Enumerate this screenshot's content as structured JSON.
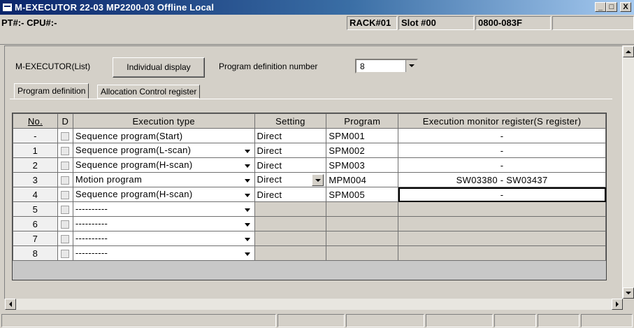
{
  "window": {
    "title": "M-EXECUTOR   22-03   MP2200-03 Offline  Local",
    "minimize": "_",
    "maximize": "□",
    "close": "X"
  },
  "status": {
    "pt_cpu": "PT#:- CPU#:-",
    "rack": "RACK#01",
    "slot": "Slot #00",
    "address": "0800-083F"
  },
  "toolbar": {
    "list_label": "M-EXECUTOR(List)",
    "individual_display_button": "Individual display",
    "program_def_label": "Program definition number",
    "program_def_value": "8"
  },
  "tabs": [
    {
      "label": "Program definition",
      "active": true
    },
    {
      "label": "Allocation Control register",
      "active": false
    }
  ],
  "table": {
    "headers": [
      "No.",
      "D",
      "Execution type",
      "Setting",
      "Program",
      "Execution monitor register(S register)"
    ],
    "rows": [
      {
        "no": "-",
        "type": "Sequence program(Start)",
        "setting": "Direct",
        "program": "SPM001",
        "monitor": "-"
      },
      {
        "no": "1",
        "type": "Sequence program(L-scan)",
        "setting": "Direct",
        "program": "SPM002",
        "monitor": "-"
      },
      {
        "no": "2",
        "type": "Sequence program(H-scan)",
        "setting": "Direct",
        "program": "SPM003",
        "monitor": "-"
      },
      {
        "no": "3",
        "type": "Motion program",
        "setting": "Direct",
        "program": "MPM004",
        "monitor": "SW03380 - SW03437"
      },
      {
        "no": "4",
        "type": "Sequence program(H-scan)",
        "setting": "Direct",
        "program": "SPM005",
        "monitor": "-"
      },
      {
        "no": "5",
        "type": "----------",
        "setting": "",
        "program": "",
        "monitor": ""
      },
      {
        "no": "6",
        "type": "----------",
        "setting": "",
        "program": "",
        "monitor": ""
      },
      {
        "no": "7",
        "type": "----------",
        "setting": "",
        "program": "",
        "monitor": ""
      },
      {
        "no": "8",
        "type": "----------",
        "setting": "",
        "program": "",
        "monitor": ""
      }
    ]
  }
}
